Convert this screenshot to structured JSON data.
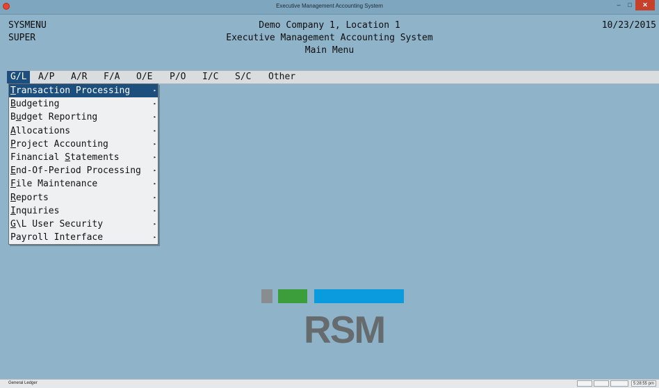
{
  "window": {
    "title": "Executive Management Accounting System",
    "app_icon": "red-circle-icon",
    "minimize_glyph": "–",
    "maximize_glyph": "□",
    "close_glyph": "✕"
  },
  "header": {
    "program_id": "SYSMENU",
    "user": "SUPER",
    "company": "Demo Company 1, Location 1",
    "system_name": "Executive Management Accounting System",
    "screen_name": "Main Menu",
    "date": "10/23/2015"
  },
  "menubar": {
    "items": [
      "G/L",
      "A/P",
      "A/R",
      "F/A",
      "O/E",
      "P/O",
      "I/C",
      "S/C",
      "Other"
    ],
    "active": "G/L"
  },
  "dropdown": {
    "arrow_glyph": "▸",
    "items": [
      {
        "label": "Transaction Processing",
        "mnemonic_index": 0,
        "selected": true
      },
      {
        "label": "Budgeting",
        "mnemonic_index": 0
      },
      {
        "label": "Budget Reporting",
        "mnemonic_index": 1
      },
      {
        "label": "Allocations",
        "mnemonic_index": 0
      },
      {
        "label": "Project Accounting",
        "mnemonic_index": 0
      },
      {
        "label": "Financial Statements",
        "mnemonic_index": 10
      },
      {
        "label": "End-Of-Period Processing",
        "mnemonic_index": 0
      },
      {
        "label": "File Maintenance",
        "mnemonic_index": 0
      },
      {
        "label": "Reports",
        "mnemonic_index": 0
      },
      {
        "label": "Inquiries",
        "mnemonic_index": 0
      },
      {
        "label": "G\\L User Security",
        "mnemonic_index": 0
      },
      {
        "label": "Payroll Interface",
        "mnemonic_index": -1
      }
    ]
  },
  "logo": {
    "text": "RSM",
    "colors": [
      "#8a8d8f",
      "#3c9e3a",
      "#0a9ade"
    ]
  },
  "statusbar": {
    "left_text": "General Ledger",
    "clock": "5:28:55 pm"
  }
}
